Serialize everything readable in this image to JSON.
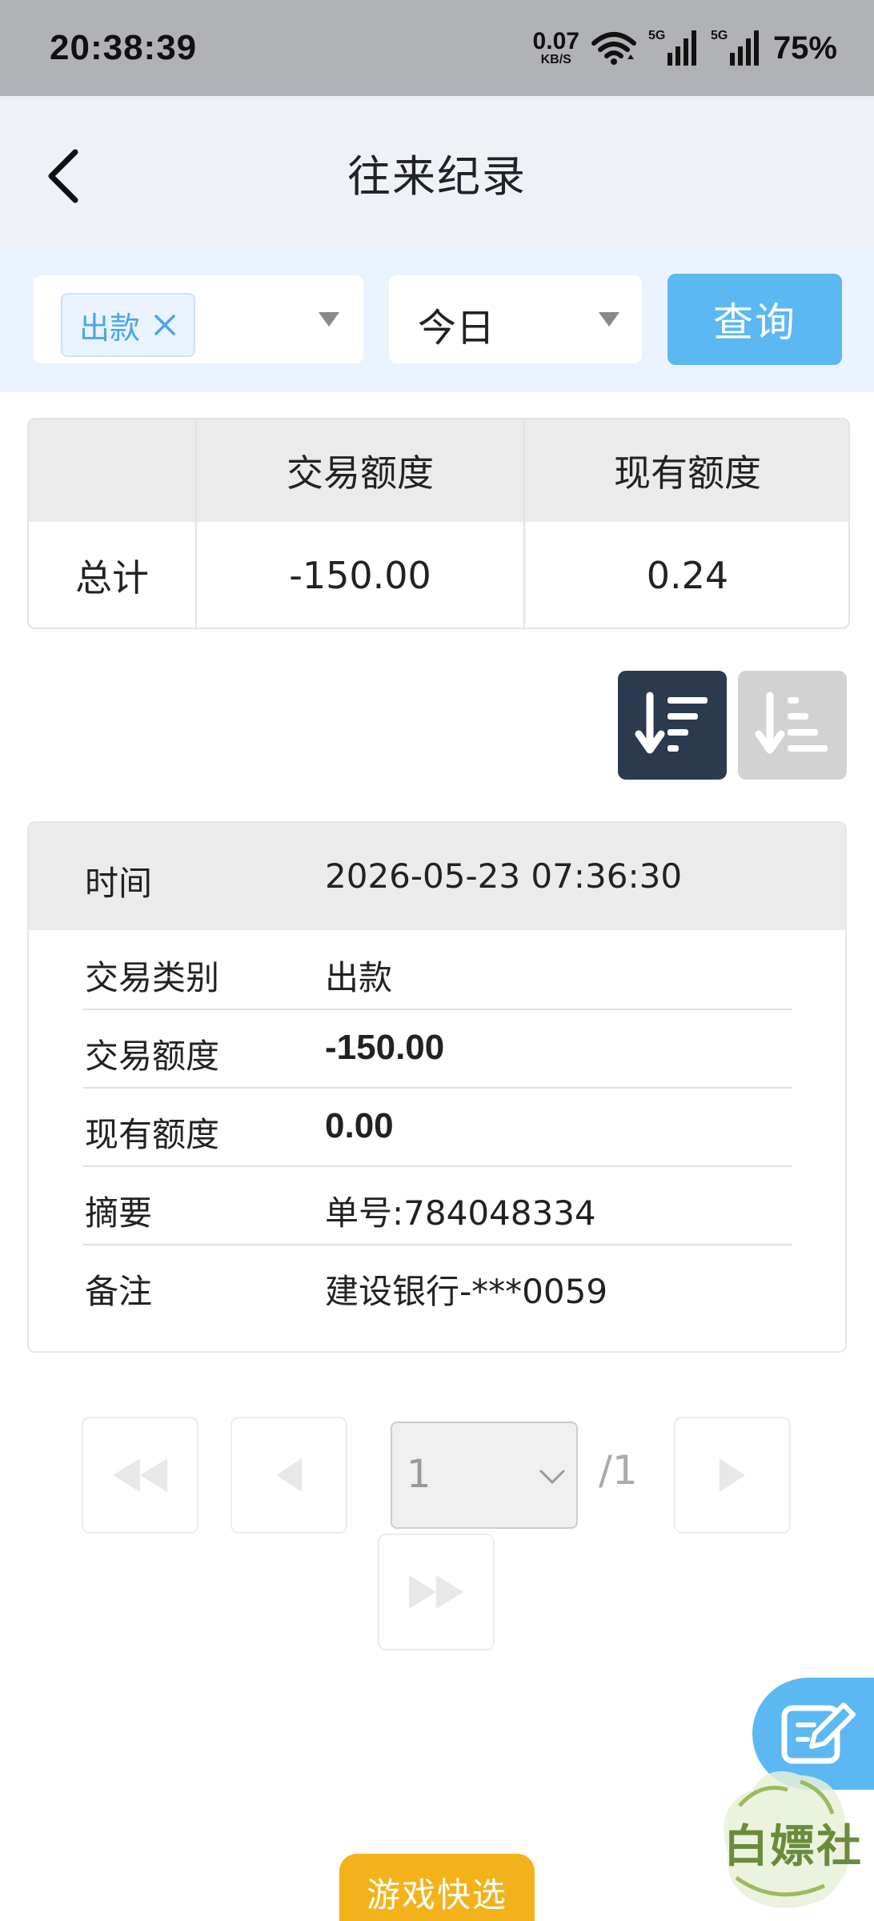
{
  "status_bar": {
    "time": "20:38:39",
    "net_speed": "0.07",
    "net_unit": "KB/S",
    "signal1_tag": "5G",
    "signal2_tag": "5G",
    "battery": "75%"
  },
  "header": {
    "title": "往来纪录"
  },
  "filters": {
    "type_tag": "出款",
    "date_range": "今日",
    "query_label": "查询"
  },
  "summary": {
    "headers": [
      "",
      "交易额度",
      "现有额度"
    ],
    "row_label": "总计",
    "trade_amount": "-150.00",
    "current_amount": "0.24"
  },
  "record": {
    "time_label": "时间",
    "time_value": "2026-05-23 07:36:30",
    "type_label": "交易类别",
    "type_value": "出款",
    "amount_label": "交易额度",
    "amount_value": "-150.00",
    "balance_label": "现有额度",
    "balance_value": "0.00",
    "summary_label": "摘要",
    "summary_value": "单号:784048334",
    "remark_label": "备注",
    "remark_value": "建设银行-***0059"
  },
  "pagination": {
    "current_page": "1",
    "total": "/1"
  },
  "watermark_text": "白嫖社",
  "game_button": "游戏快选",
  "colors": {
    "accent": "#5bb8f2",
    "sort_active": "#2c3a4f",
    "game_button": "#f4b21a"
  }
}
